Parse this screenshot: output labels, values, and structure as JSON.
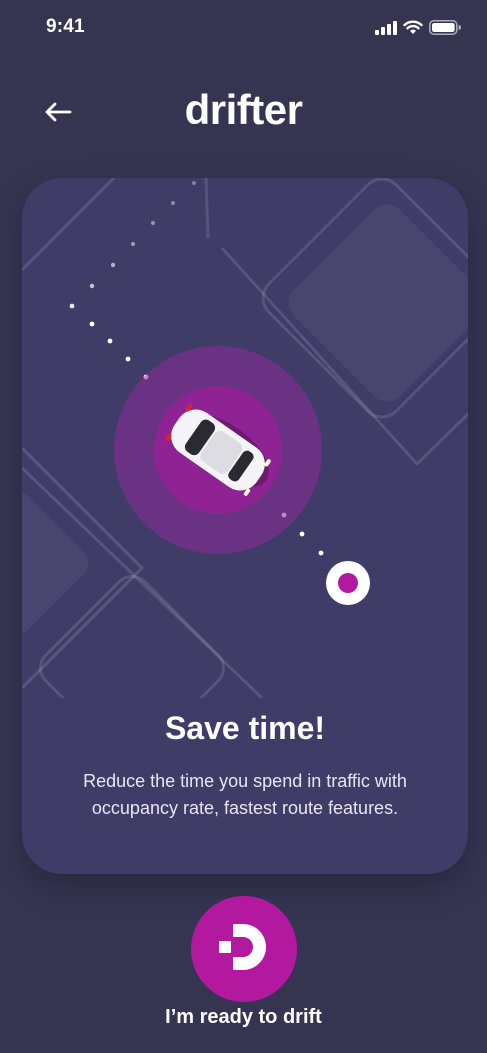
{
  "status_bar": {
    "time": "9:41",
    "icons": [
      "signal-icon",
      "wifi-icon",
      "battery-icon"
    ]
  },
  "header": {
    "back_icon": "arrow-left-icon",
    "logo_text": "drifter"
  },
  "card": {
    "title": "Save time!",
    "description": "Reduce the time you spend in traffic with occupancy rate, fastest route features."
  },
  "cta": {
    "icon": "drifter-d-icon",
    "label": "I’m ready to drift"
  },
  "colors": {
    "background": "#353552",
    "card": "#403c68",
    "accent": "#b3199e",
    "text": "#ffffff"
  }
}
